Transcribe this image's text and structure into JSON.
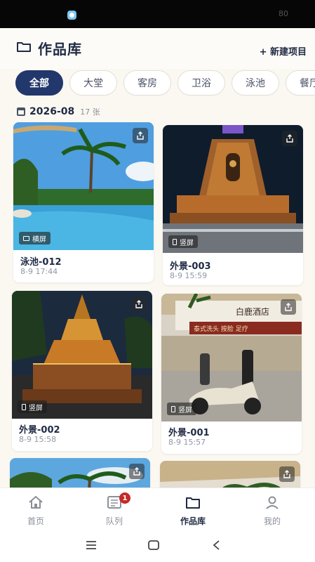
{
  "status_bar": {
    "right_text": "80"
  },
  "header": {
    "title": "作品库",
    "new_project_label": "+ 新建项目"
  },
  "filters": [
    {
      "label": "全部",
      "active": true
    },
    {
      "label": "大堂",
      "active": false
    },
    {
      "label": "客房",
      "active": false
    },
    {
      "label": "卫浴",
      "active": false
    },
    {
      "label": "泳池",
      "active": false
    },
    {
      "label": "餐厅",
      "active": false
    }
  ],
  "section": {
    "date": "2026-08",
    "count": "17 张"
  },
  "works": [
    {
      "name": "泳池-012",
      "time": "8-9 17:44",
      "orientation": "横屏",
      "scene": "pool"
    },
    {
      "name": "外景-003",
      "time": "8-9 15:59",
      "orientation": "竖屏",
      "scene": "temple-night"
    },
    {
      "name": "外景-002",
      "time": "8-9 15:58",
      "orientation": "竖屏",
      "scene": "pagoda-dusk"
    },
    {
      "name": "外景-001",
      "time": "8-9 15:57",
      "orientation": "竖屏",
      "scene": "street-scooter"
    },
    {
      "name": "",
      "time": "",
      "orientation": "",
      "scene": "palms"
    },
    {
      "name": "",
      "time": "",
      "orientation": "",
      "scene": "awning"
    }
  ],
  "scene_signs": {
    "hotel_name": "白鹿酒店",
    "shop_sign": "泰式洗头 按脸 足疗"
  },
  "bottom_nav": [
    {
      "label": "首页",
      "icon": "home-icon",
      "active": false
    },
    {
      "label": "队列",
      "icon": "queue-icon",
      "active": false,
      "badge": "1"
    },
    {
      "label": "作品库",
      "icon": "folder-icon",
      "active": true
    },
    {
      "label": "我的",
      "icon": "profile-icon",
      "active": false
    }
  ],
  "colors": {
    "accent": "#22376b",
    "badge": "#c62828",
    "background": "#fbf8f2"
  }
}
